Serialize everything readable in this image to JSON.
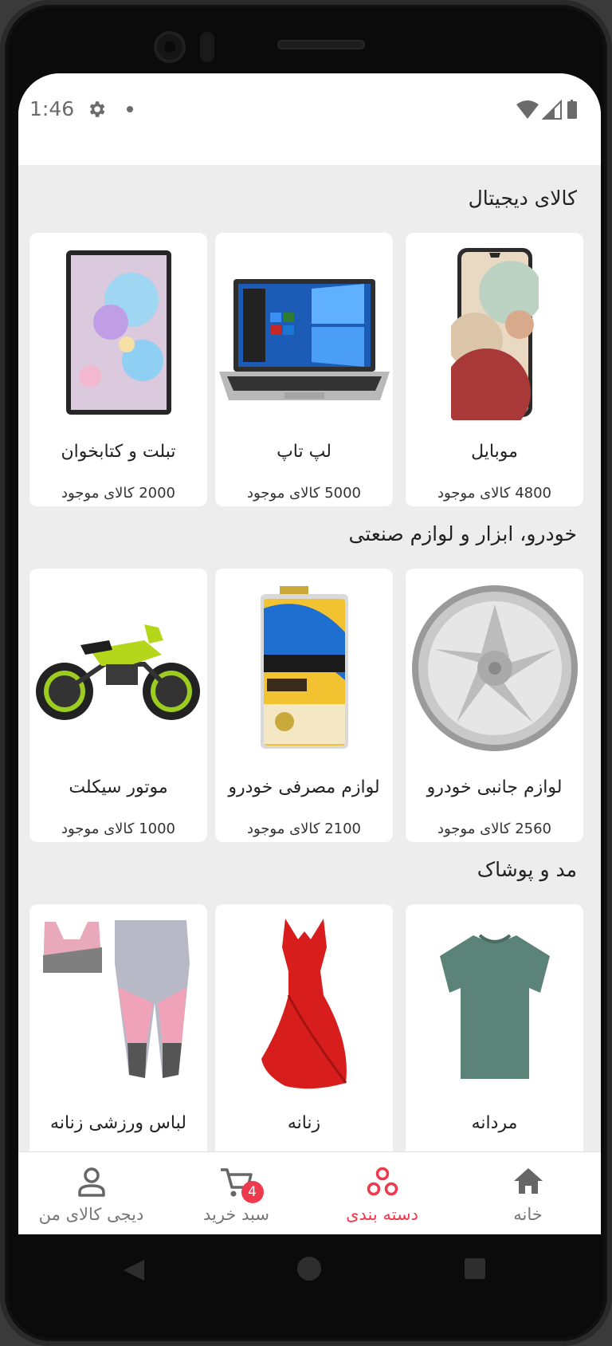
{
  "status_bar": {
    "time": "1:46"
  },
  "sections": [
    {
      "title": "کالای دیجیتال",
      "items": [
        {
          "name": "موبایل",
          "count": "4800 کالای موجود"
        },
        {
          "name": "لپ تاپ",
          "count": "5000 کالای موجود"
        },
        {
          "name": "تبلت و کتابخوان",
          "count": "2000 کالای موجود"
        }
      ]
    },
    {
      "title": "خودرو، ابزار و لوازم صنعتی",
      "items": [
        {
          "name": "لوازم جانبی خودرو",
          "count": "2560 کالای موجود"
        },
        {
          "name": "لوازم مصرفی خودرو",
          "count": "2100 کالای موجود"
        },
        {
          "name": "موتور سیکلت",
          "count": "1000 کالای موجود"
        }
      ]
    },
    {
      "title": "مد و پوشاک",
      "items": [
        {
          "name": "مردانه"
        },
        {
          "name": "زنانه"
        },
        {
          "name": "لباس ورزشی زنانه"
        }
      ]
    }
  ],
  "bottom_nav": {
    "home": "خانه",
    "categories": "دسته بندی",
    "cart": "سبد خرید",
    "cart_badge": "4",
    "profile": "دیجی کالای من"
  },
  "colors": {
    "accent": "#ef394e",
    "background": "#ededed"
  }
}
